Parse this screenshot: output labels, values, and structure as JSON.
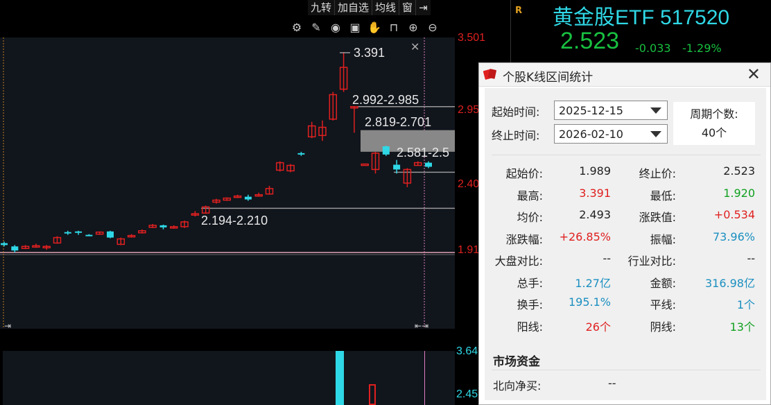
{
  "toolbar": {
    "menu": [
      "九转",
      "加自选",
      "均线",
      "窗"
    ],
    "icons": [
      "gear-icon",
      "pen-icon",
      "eye-icon",
      "box-icon",
      "hand-icon",
      "lock-icon",
      "zoom-in-icon",
      "zoom-out-icon"
    ]
  },
  "chart": {
    "y_labels": [
      "3.501",
      "2.95",
      "2.40",
      "1.91"
    ],
    "sub_y_labels": [
      "3.64",
      "2.45"
    ],
    "annotations": {
      "high": "3.391",
      "gap1": "2.992-2.985",
      "gap2": "2.819-2.701",
      "gap3": "2.581-2.5",
      "gap4": "2.194-2.210"
    }
  },
  "quote": {
    "mark": "R",
    "name": "黄金股ETF 517520",
    "price": "2.523",
    "change": "-0.033",
    "pct": "-1.29%"
  },
  "dialog": {
    "title": "个股K线区间统计",
    "start_label": "起始时间:",
    "start_value": "2025-12-15",
    "end_label": "终止时间:",
    "end_value": "2026-02-10",
    "period_label": "周期个数:",
    "period_value": "40个",
    "stats": [
      {
        "l1": "起始价:",
        "v1": "1.989",
        "c1": "",
        "l2": "终止价:",
        "v2": "2.523",
        "c2": ""
      },
      {
        "l1": "最高:",
        "v1": "3.391",
        "c1": "red",
        "l2": "最低:",
        "v2": "1.920",
        "c2": "green"
      },
      {
        "l1": "均价:",
        "v1": "2.493",
        "c1": "",
        "l2": "涨跌值:",
        "v2": "+0.534",
        "c2": "red"
      },
      {
        "l1": "涨跌幅:",
        "v1": "+26.85%",
        "c1": "red",
        "l2": "振幅:",
        "v2": "73.96%",
        "c2": "blue"
      },
      {
        "l1": "大盘对比:",
        "v1": "--",
        "c1": "",
        "l2": "行业对比:",
        "v2": "--",
        "c2": ""
      },
      {
        "l1": "总手:",
        "v1": "1.27亿",
        "c1": "blue",
        "l2": "金额:",
        "v2": "316.98亿",
        "c2": "blue"
      },
      {
        "l1": "换手:",
        "v1": "195.1%",
        "c1": "blue",
        "l2": "平线:",
        "v2": "1个",
        "c2": "blue"
      },
      {
        "l1": "阳线:",
        "v1": "26个",
        "c1": "red",
        "l2": "阴线:",
        "v2": "13个",
        "c2": "green"
      }
    ],
    "market_title": "市场资金",
    "north_label": "北向净买:",
    "north_value": "--"
  },
  "candles": [
    {
      "o": 1.989,
      "c": 1.975,
      "h": 2.0,
      "l": 1.965
    },
    {
      "o": 1.965,
      "c": 1.935,
      "h": 1.975,
      "l": 1.92
    },
    {
      "o": 1.95,
      "c": 1.965,
      "h": 1.975,
      "l": 1.945
    },
    {
      "o": 1.96,
      "c": 1.97,
      "h": 1.985,
      "l": 1.955
    },
    {
      "o": 1.955,
      "c": 1.965,
      "h": 1.975,
      "l": 1.94
    },
    {
      "o": 1.99,
      "c": 2.03,
      "h": 2.04,
      "l": 1.985
    },
    {
      "o": 2.07,
      "c": 2.06,
      "h": 2.08,
      "l": 2.05
    },
    {
      "o": 2.075,
      "c": 2.065,
      "h": 2.08,
      "l": 2.05
    },
    {
      "o": 2.05,
      "c": 2.045,
      "h": 2.055,
      "l": 2.04
    },
    {
      "o": 2.055,
      "c": 2.07,
      "h": 2.075,
      "l": 2.05
    },
    {
      "o": 2.075,
      "c": 2.03,
      "h": 2.08,
      "l": 2.025
    },
    {
      "o": 1.98,
      "c": 2.02,
      "h": 2.03,
      "l": 1.975
    },
    {
      "o": 2.035,
      "c": 2.045,
      "h": 2.055,
      "l": 2.03
    },
    {
      "o": 2.065,
      "c": 2.08,
      "h": 2.09,
      "l": 2.06
    },
    {
      "o": 2.105,
      "c": 2.12,
      "h": 2.13,
      "l": 2.1
    },
    {
      "o": 2.12,
      "c": 2.105,
      "h": 2.125,
      "l": 2.09
    },
    {
      "o": 2.105,
      "c": 2.11,
      "h": 2.12,
      "l": 2.095
    },
    {
      "o": 2.11,
      "c": 2.145,
      "h": 2.155,
      "l": 2.1
    },
    {
      "o": 2.2,
      "c": 2.205,
      "h": 2.225,
      "l": 2.185
    },
    {
      "o": 2.21,
      "c": 2.255,
      "h": 2.265,
      "l": 2.205
    },
    {
      "o": 2.29,
      "c": 2.305,
      "h": 2.315,
      "l": 2.28
    },
    {
      "o": 2.305,
      "c": 2.32,
      "h": 2.325,
      "l": 2.3
    },
    {
      "o": 2.33,
      "c": 2.335,
      "h": 2.345,
      "l": 2.32
    },
    {
      "o": 2.33,
      "c": 2.31,
      "h": 2.345,
      "l": 2.3
    },
    {
      "o": 2.335,
      "c": 2.345,
      "h": 2.36,
      "l": 2.33
    },
    {
      "o": 2.35,
      "c": 2.39,
      "h": 2.41,
      "l": 2.345
    },
    {
      "o": 2.525,
      "c": 2.58,
      "h": 2.59,
      "l": 2.515
    },
    {
      "o": 2.52,
      "c": 2.56,
      "h": 2.57,
      "l": 2.51
    },
    {
      "o": 2.65,
      "c": 2.64,
      "h": 2.66,
      "l": 2.63
    },
    {
      "o": 2.77,
      "c": 2.85,
      "h": 2.88,
      "l": 2.76
    },
    {
      "o": 2.78,
      "c": 2.84,
      "h": 2.89,
      "l": 2.74
    },
    {
      "o": 2.9,
      "c": 3.08,
      "h": 3.1,
      "l": 2.89
    },
    {
      "o": 3.12,
      "c": 3.28,
      "h": 3.391,
      "l": 3.1
    },
    {
      "o": 2.992,
      "c": 2.992,
      "h": 2.992,
      "l": 2.8
    },
    {
      "o": 2.57,
      "c": 2.57,
      "h": 2.57,
      "l": 2.57
    },
    {
      "o": 2.53,
      "c": 2.65,
      "h": 2.66,
      "l": 2.5
    },
    {
      "o": 2.7,
      "c": 2.64,
      "h": 2.705,
      "l": 2.63
    },
    {
      "o": 2.565,
      "c": 2.53,
      "h": 2.6,
      "l": 2.5
    },
    {
      "o": 2.43,
      "c": 2.53,
      "h": 2.54,
      "l": 2.4
    },
    {
      "o": 2.56,
      "c": 2.58,
      "h": 2.59,
      "l": 2.56
    },
    {
      "o": 2.58,
      "c": 2.55,
      "h": 2.59,
      "l": 2.54
    }
  ]
}
